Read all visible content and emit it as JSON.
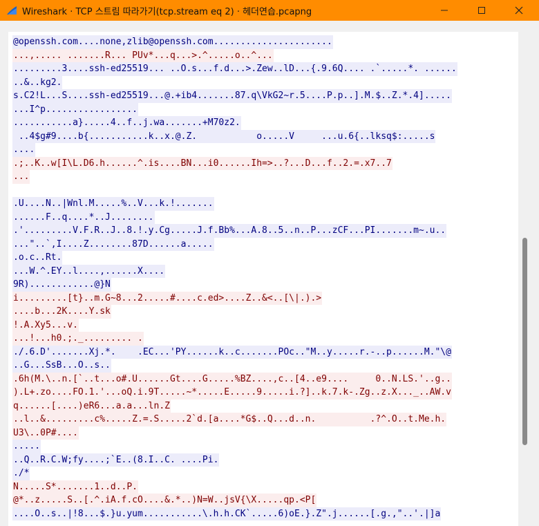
{
  "window": {
    "title": "Wireshark · TCP 스트림 따라가기(tcp.stream eq 2) · 헤더연습.pcapng",
    "icon": "wireshark-fin-icon",
    "controls": [
      "minimize-icon",
      "maximize-icon",
      "close-icon"
    ],
    "title_bar_color": "#ff8c00"
  },
  "colors": {
    "client_bg": "#fbeded",
    "client_fg": "#7f0000",
    "server_bg": "#ececfa",
    "server_fg": "#00007f"
  },
  "stream": [
    {
      "dir": "server",
      "text": "@openssh.com....none,zlib@openssh.com......................"
    },
    {
      "dir": "client",
      "text": "...,..... .......R... PUv*...q...>.^.....o..^..."
    },
    {
      "dir": "server",
      "text": ".........3....ssh-ed25519... ..O.s...f.d...>.Zew..lD...{.9.6Q.... .`.....*. ......"
    },
    {
      "dir": "server",
      "text": "..&..kg2."
    },
    {
      "dir": "server",
      "text": "s.C2!L...S....ssh-ed25519...@.+ib4.......87.q\\VkG2~r.5....P.p..].M.$..Z.*.4]....."
    },
    {
      "dir": "server",
      "text": "...I^p................."
    },
    {
      "dir": "server",
      "text": "...........a}.....4..f..j.wa.......+M70z2."
    },
    {
      "dir": "server",
      "text": " ..4$g#9....b{...........k..x.@.Z.           o.....V     ...u.6{..lksq$:.....s"
    },
    {
      "dir": "server",
      "text": "...."
    },
    {
      "dir": "client",
      "text": ".;..K..w[I\\L.D6.h......^.is....BN...i0......Ih=>..?...D...f..2.=.x7..7"
    },
    {
      "dir": "client",
      "text": "..."
    },
    {
      "dir": "blank",
      "text": ""
    },
    {
      "dir": "server",
      "text": ".U....N..|Wnl.M.....%..V...k.!......."
    },
    {
      "dir": "server",
      "text": "......F..q....*..J........"
    },
    {
      "dir": "server",
      "text": ".'.........V.F.R..J..8.!.y.Cg.....J.f.Bb%...A.8..5..n..P...zCF...PI.......m~.u.."
    },
    {
      "dir": "server",
      "text": "...\"..`,I....Z........87D......a....."
    },
    {
      "dir": "server",
      "text": ".o.c..Rt."
    },
    {
      "dir": "server",
      "text": "...W.^.EY..l....,......X...."
    },
    {
      "dir": "server",
      "text": "9R)............@}N"
    },
    {
      "dir": "client",
      "text": "i.........[t}..m.G~8...2.....#....c.ed>....Z..&<..[\\|.).>"
    },
    {
      "dir": "client",
      "text": "....b...2K....Y.sk"
    },
    {
      "dir": "client",
      "text": "!.A.Xy5...v."
    },
    {
      "dir": "client",
      "text": "...!...h0.;._......... ."
    },
    {
      "dir": "server",
      "text": "./.6.D'.......Xj.*.    .EC...'PY......k..c.......POc..\"M..y.....r.-..p......M.\"\\@"
    },
    {
      "dir": "server",
      "text": "..G...SsB...O..s.."
    },
    {
      "dir": "client",
      "text": ".6h(M.\\..n.[`..t...o#.U......Gt....G.....%BZ....,c..[4..e9....     0..N.LS.'..g.."
    },
    {
      "dir": "client",
      "text": ").L+.zo....FO.1.'...oQ.i.9T.....~*.....E.....9.....i.?]..k.7.k-.Zg..z.X..._..AW.v"
    },
    {
      "dir": "client",
      "text": "q......[....)eR6...a.a...ln.Z"
    },
    {
      "dir": "client",
      "text": "..l..&.........c%.....Z.=.S.....2`d.[a....*G$..Q...d..n.          .?^.O..t.Me.h."
    },
    {
      "dir": "client",
      "text": "U3\\..0P#...."
    },
    {
      "dir": "server",
      "text": "....."
    },
    {
      "dir": "server",
      "text": "..Q..R.C.W;fy....;`E..(8.I..C. ....Pi."
    },
    {
      "dir": "server",
      "text": "./*"
    },
    {
      "dir": "client",
      "text": "N.....S*.......1..d..P."
    },
    {
      "dir": "client",
      "text": "@*..z.....S..[.^.iA.f.cO....&.*..)N=W..jsV{\\X.....qp.<P["
    },
    {
      "dir": "server",
      "text": "....O..s..|!8...$.}u.yum...........\\.h.h.CK`.....6)oE.}.Z\".j......[.g.,\"..'.|]a"
    }
  ]
}
